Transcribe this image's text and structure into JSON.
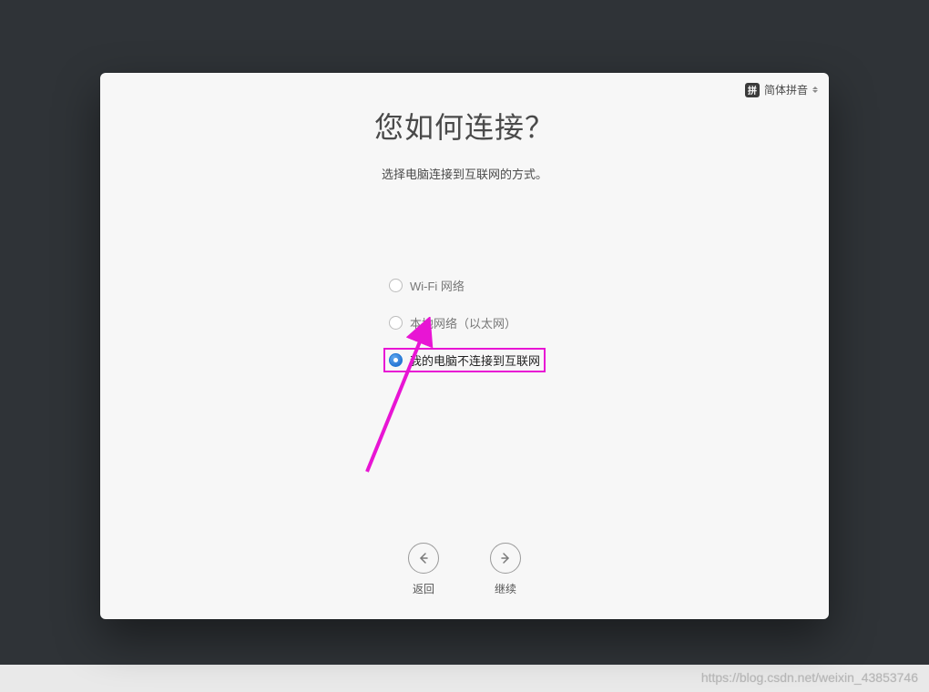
{
  "ime": {
    "badge": "拼",
    "label": "简体拼音"
  },
  "heading": {
    "title": "您如何连接？",
    "subtitle": "选择电脑连接到互联网的方式。"
  },
  "options": {
    "wifi": "Wi-Fi 网络",
    "ethernet": "本地网络（以太网）",
    "none": "我的电脑不连接到互联网"
  },
  "nav": {
    "back": "返回",
    "continue": "继续"
  },
  "watermark": "https://blog.csdn.net/weixin_43853746"
}
